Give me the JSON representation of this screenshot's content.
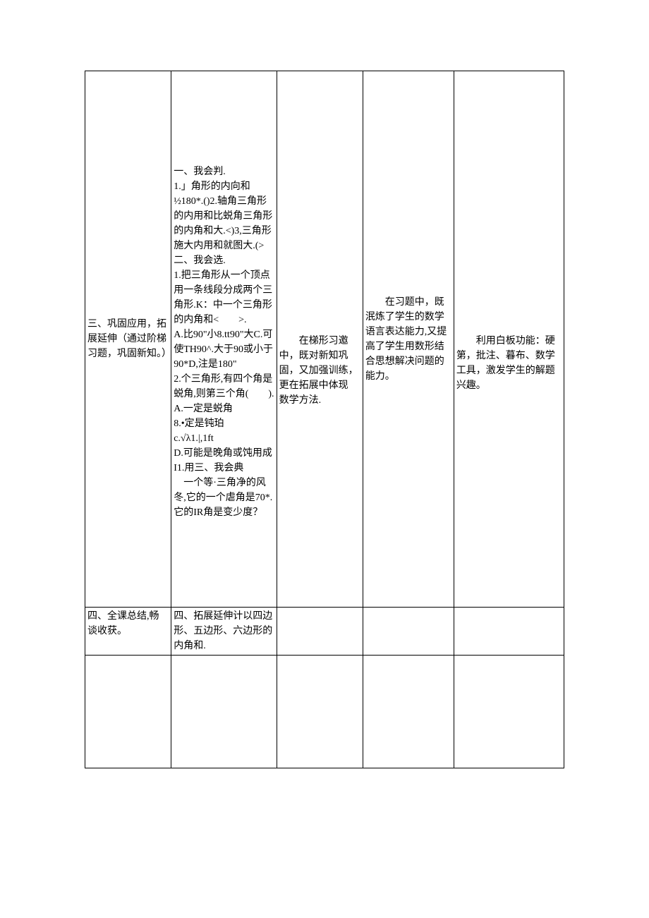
{
  "row1": {
    "col1": "三、巩固应用，拓展延伸（通过阶梯习题，巩固新知。）",
    "col2": "一、我会判.\n1.」角形的内向和½180*.()2.轴角三角形的内用和比蜕角三角形的内角和大.<)3,三角形施大内用和就图大.(>二、我会选.\n1.把三角形从一个顶点用一条线段分成两个三角形.K：中一个三角形的内角和<　　>.\nA.比90\"小8.tt90\"大C.可使TH90^.大于90或小于90*D,注是180\"\n2.个三角形,有四个角是蜕角,则第三个角(　　).\nA.一定是蜕角\n8.•定是钝珀\nc.√λ1.|,1ft\nD.可能是晚角或饨用成I1.用三、我会典\n　一个等·三角净的风冬,它的一个虐角是70*.它的IR角是变少度？",
    "col3_p1": "　　在梯形习邀中，既对新知巩固，又加强训练，更在拓展中体现",
    "col3_p2": "数学方法.",
    "col4": "　　在习题中，既泯炼了学生的数学语言表达能力,又提高了学生用数形结合思想解决问题的能力。",
    "col5": "　　利用白板功能：硬第，批注、暮布、数学工具，激发学生的解题兴趣。"
  },
  "row2": {
    "col1": "四、全课总结,畅谈收获。",
    "col2": "四、拓展延伸计以四边形、五边形、六边形的内角和."
  }
}
